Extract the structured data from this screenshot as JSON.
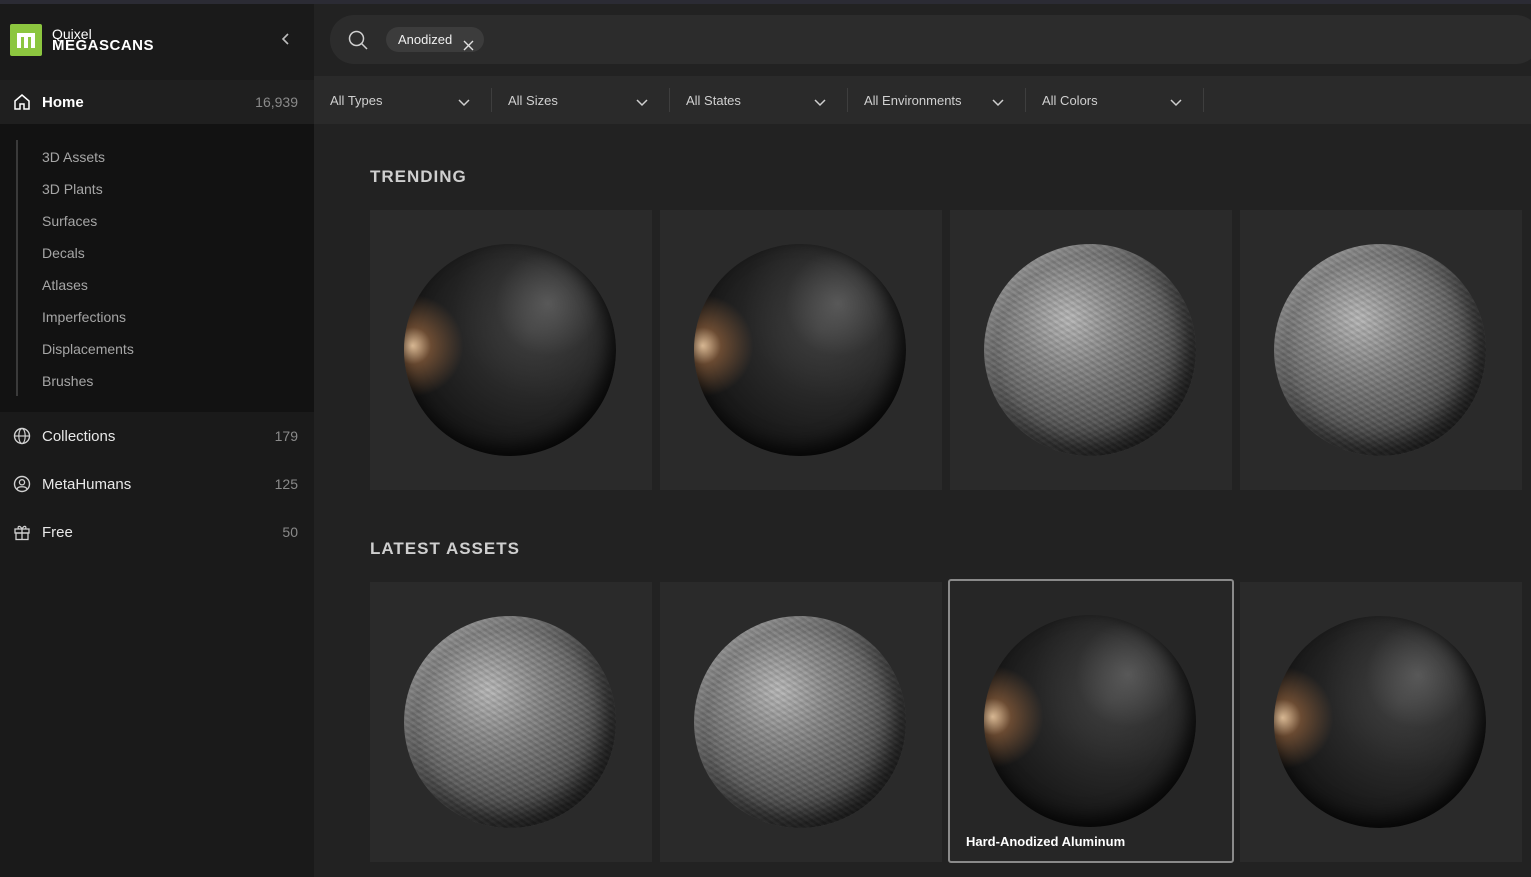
{
  "brand": {
    "top": "Quixel",
    "bottom": "MEGASCANS"
  },
  "nav": {
    "home": {
      "label": "Home",
      "count": "16,939"
    },
    "sub_items": [
      "3D Assets",
      "3D Plants",
      "Surfaces",
      "Decals",
      "Atlases",
      "Imperfections",
      "Displacements",
      "Brushes"
    ],
    "collections": {
      "label": "Collections",
      "count": "179"
    },
    "metahumans": {
      "label": "MetaHumans",
      "count": "125"
    },
    "free": {
      "label": "Free",
      "count": "50"
    }
  },
  "search": {
    "chip": "Anodized"
  },
  "filters": [
    "All Types",
    "All Sizes",
    "All States",
    "All Environments",
    "All Colors"
  ],
  "sections": {
    "trending": "TRENDING",
    "latest": "LATEST ASSETS"
  },
  "cards": {
    "hovered_label": "Hard-Anodized Aluminum"
  },
  "colors": {
    "brand_green": "#8cc63f",
    "background": "#202020"
  }
}
